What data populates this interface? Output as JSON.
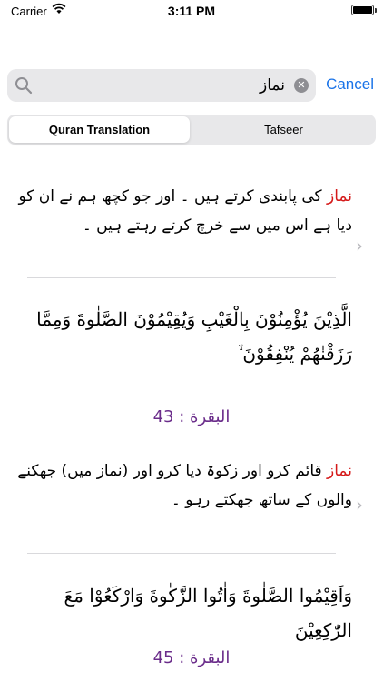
{
  "status_bar": {
    "carrier": "Carrier",
    "time": "3:11 PM"
  },
  "search": {
    "value": "نماز",
    "cancel_label": "Cancel"
  },
  "segments": [
    {
      "label": "Quran Translation",
      "selected": true
    },
    {
      "label": "Tafseer",
      "selected": false
    }
  ],
  "results": [
    {
      "highlight": "نماز",
      "translation": " کی پابندی کرتے ہیں ۔ اور جو کچھ ہم نے ان کو دیا ہے اس میں سے خرچ کرتے رہتے ہیں ۔",
      "arabic": "الَّذِيْنَ يُؤْمِنُوْنَ بِالْغَيْبِ وَيُقِيْمُوْنَ الصَّلٰوةَ وَمِمَّا رَزَقْنٰهُمْ يُنْفِقُوْنَ ۙ",
      "reference": "البقرة : 43"
    },
    {
      "highlight": "نماز",
      "translation": " قائم کرو اور زکوۃ دیا کرو اور (نماز میں) جھکنے والوں کے ساتھ جھکتے رہو ۔",
      "arabic": "وَاَقِيْمُوا الصَّلٰوةَ وَاٰتُوا الزَّكٰوةَ وَارْكَعُوْا مَعَ الرّٰكِعِيْنَ",
      "reference": "البقرة : 45"
    }
  ],
  "colors": {
    "accent": "#1a73e8",
    "highlight": "#d51a1a",
    "reference": "#6a2c8a"
  }
}
